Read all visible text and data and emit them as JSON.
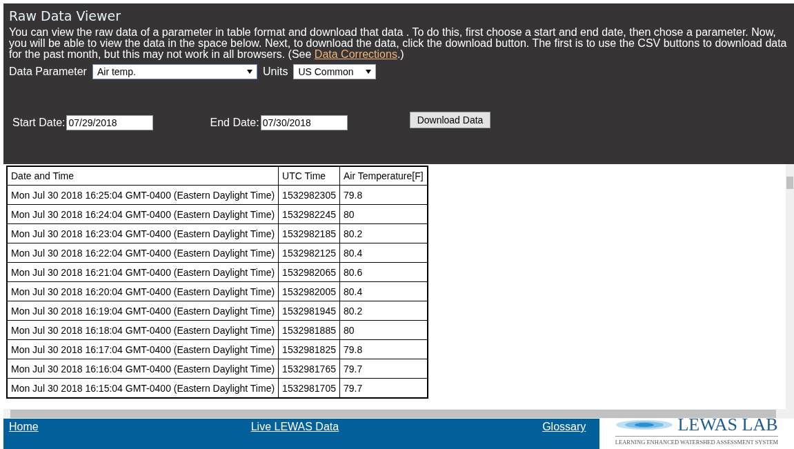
{
  "title": "Raw Data Viewer",
  "intro": {
    "text": "You can view the raw data of a parameter in table format and download that data . To do this, first choose a start and end date, then chose a parameter. Now, you will be able to view the data in the space below. Next, to download the data, click the download button. The first is to use the CSV buttons to download data for the past month, but this may not work in all browsers. (See ",
    "link": "Data Corrections",
    "after": ".)"
  },
  "parameter": {
    "label": "Data Parameter",
    "value": "Air temp."
  },
  "units": {
    "label": "Units",
    "value": "US Common"
  },
  "start_date": {
    "label": "Start Date:",
    "value": "07/29/2018"
  },
  "end_date": {
    "label": "End Date:",
    "value": "07/30/2018"
  },
  "download_button": "Download Data",
  "table": {
    "columns": [
      "Date and Time",
      "UTC Time",
      "Air Temperature[F]"
    ],
    "rows": [
      [
        "Mon Jul 30 2018 16:25:04 GMT-0400 (Eastern Daylight Time)",
        "1532982305",
        "79.8"
      ],
      [
        "Mon Jul 30 2018 16:24:04 GMT-0400 (Eastern Daylight Time)",
        "1532982245",
        "80"
      ],
      [
        "Mon Jul 30 2018 16:23:04 GMT-0400 (Eastern Daylight Time)",
        "1532982185",
        "80.2"
      ],
      [
        "Mon Jul 30 2018 16:22:04 GMT-0400 (Eastern Daylight Time)",
        "1532982125",
        "80.4"
      ],
      [
        "Mon Jul 30 2018 16:21:04 GMT-0400 (Eastern Daylight Time)",
        "1532982065",
        "80.6"
      ],
      [
        "Mon Jul 30 2018 16:20:04 GMT-0400 (Eastern Daylight Time)",
        "1532982005",
        "80.4"
      ],
      [
        "Mon Jul 30 2018 16:19:04 GMT-0400 (Eastern Daylight Time)",
        "1532981945",
        "80.2"
      ],
      [
        "Mon Jul 30 2018 16:18:04 GMT-0400 (Eastern Daylight Time)",
        "1532981885",
        "80"
      ],
      [
        "Mon Jul 30 2018 16:17:04 GMT-0400 (Eastern Daylight Time)",
        "1532981825",
        "79.8"
      ],
      [
        "Mon Jul 30 2018 16:16:04 GMT-0400 (Eastern Daylight Time)",
        "1532981765",
        "79.7"
      ],
      [
        "Mon Jul 30 2018 16:15:04 GMT-0400 (Eastern Daylight Time)",
        "1532981705",
        "79.7"
      ]
    ]
  },
  "footer": {
    "links": [
      "Home",
      "Live LEWAS Data",
      "Glossary"
    ],
    "logo": {
      "name": "LEWAS LAB",
      "tagline": "LEARNING ENHANCED WATERSHED ASSESSMENT SYSTEM"
    }
  }
}
